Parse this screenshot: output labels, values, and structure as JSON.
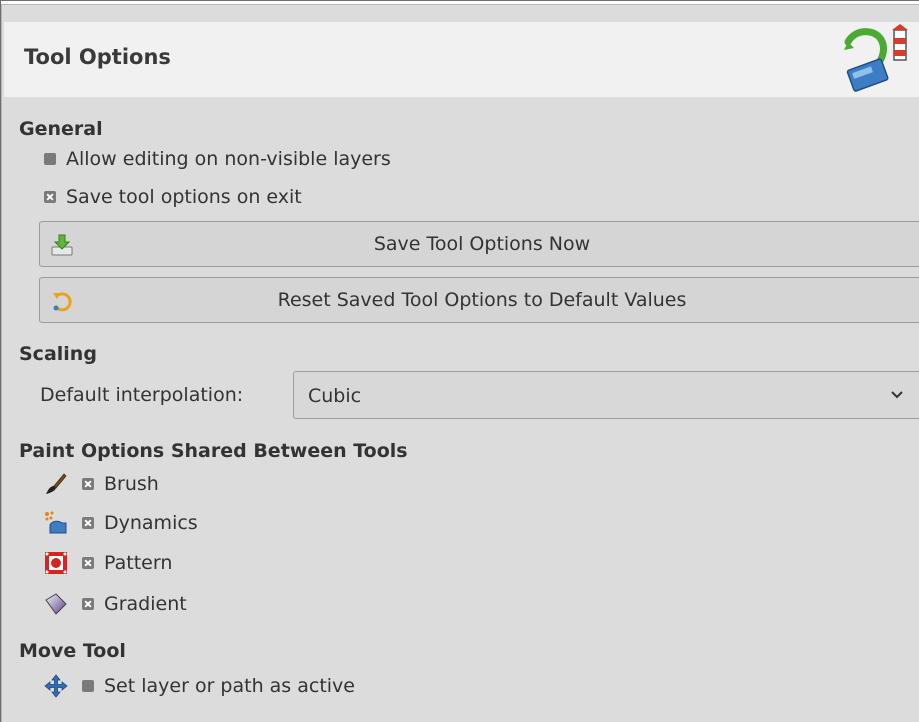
{
  "panel": {
    "title": "Tool Options",
    "header_icon": "tool-options-icon"
  },
  "general": {
    "heading": "General",
    "allow_editing": {
      "label": "Allow editing on non-visible layers",
      "checked": false
    },
    "save_on_exit": {
      "label": "Save tool options on exit",
      "checked": true
    },
    "save_now_button": {
      "label": "Save Tool Options Now",
      "icon": "save-icon"
    },
    "reset_button": {
      "label": "Reset Saved Tool Options to Default Values",
      "icon": "reset-icon"
    }
  },
  "scaling": {
    "heading": "Scaling",
    "interp_label": "Default interpolation:",
    "interp_value": "Cubic"
  },
  "paint": {
    "heading": "Paint Options Shared Between Tools",
    "items": [
      {
        "label": "Brush",
        "checked": true,
        "icon": "brush-icon"
      },
      {
        "label": "Dynamics",
        "checked": true,
        "icon": "dynamics-icon"
      },
      {
        "label": "Pattern",
        "checked": true,
        "icon": "pattern-icon"
      },
      {
        "label": "Gradient",
        "checked": true,
        "icon": "gradient-icon"
      }
    ]
  },
  "move_tool": {
    "heading": "Move Tool",
    "set_active": {
      "label": "Set layer or path as active",
      "checked": false,
      "icon": "move-icon"
    }
  }
}
